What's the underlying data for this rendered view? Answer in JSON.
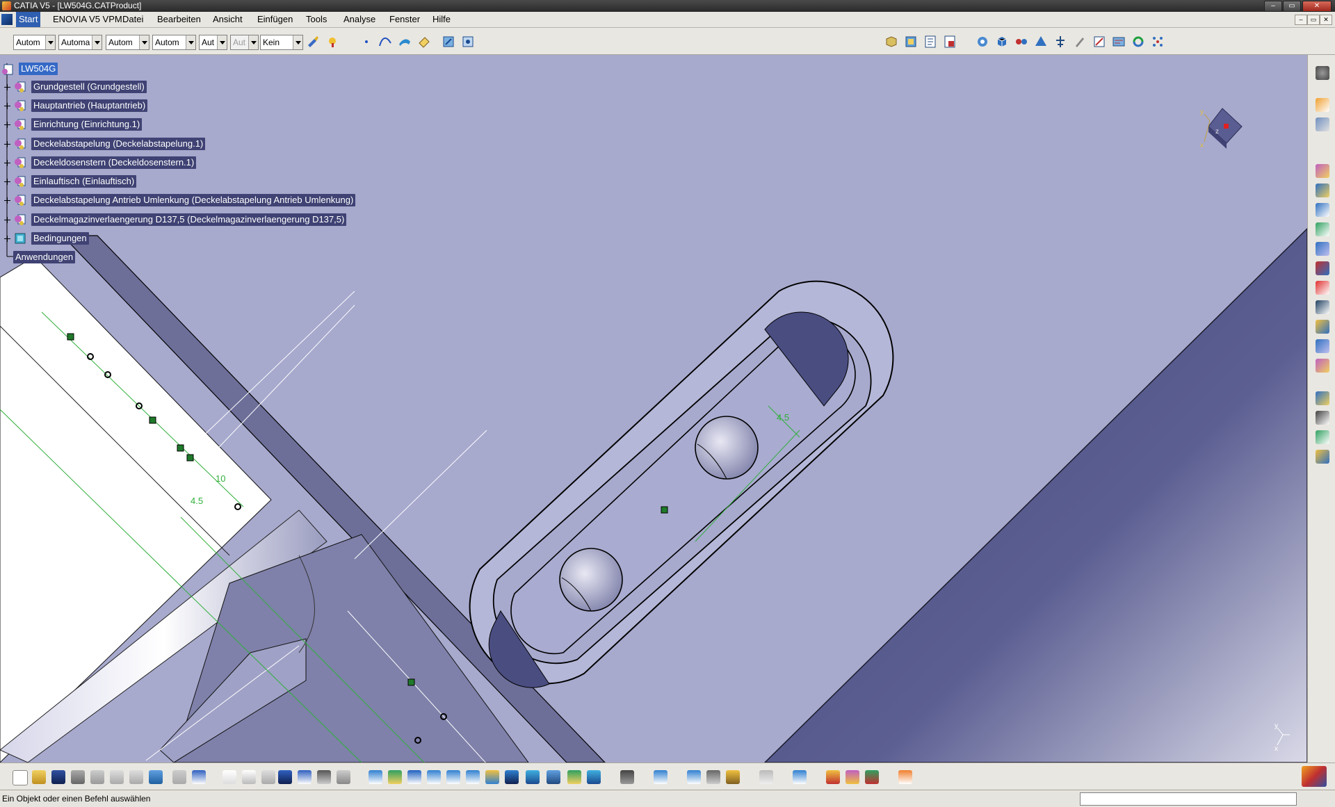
{
  "window": {
    "title": "CATIA V5 - [LW504G.CATProduct]",
    "controls": {
      "minimize": "–",
      "maximize": "▭",
      "close": "✕"
    }
  },
  "menu": {
    "items": [
      "Start",
      "ENOVIA V5 VPM",
      "Datei",
      "Bearbeiten",
      "Ansicht",
      "Einfügen",
      "Tools",
      "Analyse",
      "Fenster",
      "Hilfe"
    ],
    "mdi_controls": [
      "–",
      "▭",
      "✕"
    ]
  },
  "toolbar": {
    "combos": [
      "Autom",
      "Automa",
      "Autom",
      "Autom",
      "Aut",
      "Aut",
      "Kein"
    ],
    "icons": [
      "format-painter-icon",
      "paint-bucket-icon",
      "point-icon",
      "spline-icon",
      "surface-icon",
      "eraser-icon",
      "snap-icon",
      "view-icon",
      "product-icon",
      "component-icon",
      "existing-component-icon",
      "replace-icon",
      "assembly-icon",
      "manipulate-icon",
      "snap-move-icon",
      "explode-icon",
      "stop-icon",
      "clash-icon",
      "measure-icon",
      "annotation-icon",
      "constraint-icon",
      "update-icon",
      "catalog-icon"
    ]
  },
  "tree": {
    "root": "LW504G",
    "nodes": [
      "Grundgestell (Grundgestell)",
      "Hauptantrieb (Hauptantrieb)",
      "Einrichtung (Einrichtung.1)",
      "Deckelabstapelung (Deckelabstapelung.1)",
      "Deckeldosenstern (Deckeldosenstern.1)",
      "Einlauftisch (Einlauftisch)",
      "Deckelabstapelung Antrieb Umlenkung (Deckelabstapelung Antrieb Umlenkung)",
      "Deckelmagazinverlaengerung D137,5 (Deckelmagazinverlaengerung D137,5)"
    ],
    "constraints": "Bedingungen",
    "applications": "Anwendungen"
  },
  "viewport": {
    "dimensions": [
      "4.5",
      "10",
      "4.5"
    ],
    "compass_axes": [
      "y",
      "z",
      "x"
    ],
    "triad_axes": [
      "y",
      "x"
    ],
    "colors": {
      "background": "#a7a9cd",
      "dark_face": "#4a4d80",
      "dimension": "#2faf3a",
      "tree_highlight": "#3f4273"
    }
  },
  "right_toolbar": {
    "icons": [
      "gear-icon",
      "select-arrow-icon",
      "sketch-icon",
      "assembly-constraints-icon",
      "contact-icon",
      "offset-icon",
      "angle-icon",
      "fix-icon",
      "fix-together-icon",
      "quick-constraint-icon",
      "flexible-icon",
      "change-constraint-icon",
      "reuse-pattern-icon",
      "bill-of-material-icon",
      "scene-icon",
      "sectioning-icon",
      "distance-icon",
      "clash-detection-icon",
      "generative-icon",
      "catalog-browser-icon"
    ]
  },
  "bottom_toolbar": {
    "icons": [
      "new-icon",
      "open-icon",
      "save-icon",
      "print-icon",
      "cut-icon",
      "copy-icon",
      "paste-icon",
      "undo-icon",
      "redo-icon",
      "help-icon",
      "formula-icon",
      "comment-icon",
      "knowledge-icon",
      "table-icon",
      "tree-icon",
      "compass-icon",
      "fly-icon",
      "fit-all-icon",
      "pan-icon",
      "rotate-icon",
      "zoom-in-icon",
      "zoom-out-icon",
      "normal-view-icon",
      "multi-view-icon",
      "iso-view-icon",
      "shading-icon",
      "hide-show-icon",
      "swap-icon",
      "capture-icon",
      "measure-between-icon",
      "inertia-icon",
      "magnet-icon",
      "update-all-icon",
      "plane-icon",
      "render-icon",
      "material-icon",
      "apply-material-icon",
      "grid-icon"
    ]
  },
  "status": {
    "message": "Ein Objekt oder einen Befehl auswählen"
  }
}
